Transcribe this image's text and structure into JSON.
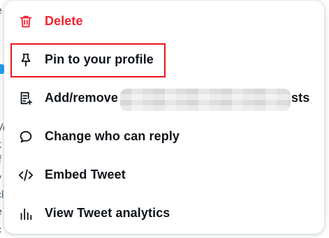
{
  "background": {
    "chars": [
      "e",
      "t",
      "Ve",
      "k",
      "if",
      "y",
      "cl",
      "e",
      "c"
    ]
  },
  "menu": {
    "items": [
      {
        "label": "Delete",
        "icon": "trash-icon",
        "danger": true
      },
      {
        "label": "Pin to your profile",
        "icon": "pin-icon",
        "highlighted": true
      },
      {
        "label": "Add/remove",
        "label_tail": "sts",
        "icon": "list-add-icon",
        "partially_redacted": true
      },
      {
        "label": "Change who can reply",
        "icon": "speech-bubble-icon"
      },
      {
        "label": "Embed Tweet",
        "icon": "code-icon"
      },
      {
        "label": "View Tweet analytics",
        "icon": "analytics-icon"
      }
    ]
  },
  "colors": {
    "danger": "#f4212e",
    "text": "#0f1419",
    "highlight_border": "#e8141b",
    "badge": "#1d9bf0"
  }
}
